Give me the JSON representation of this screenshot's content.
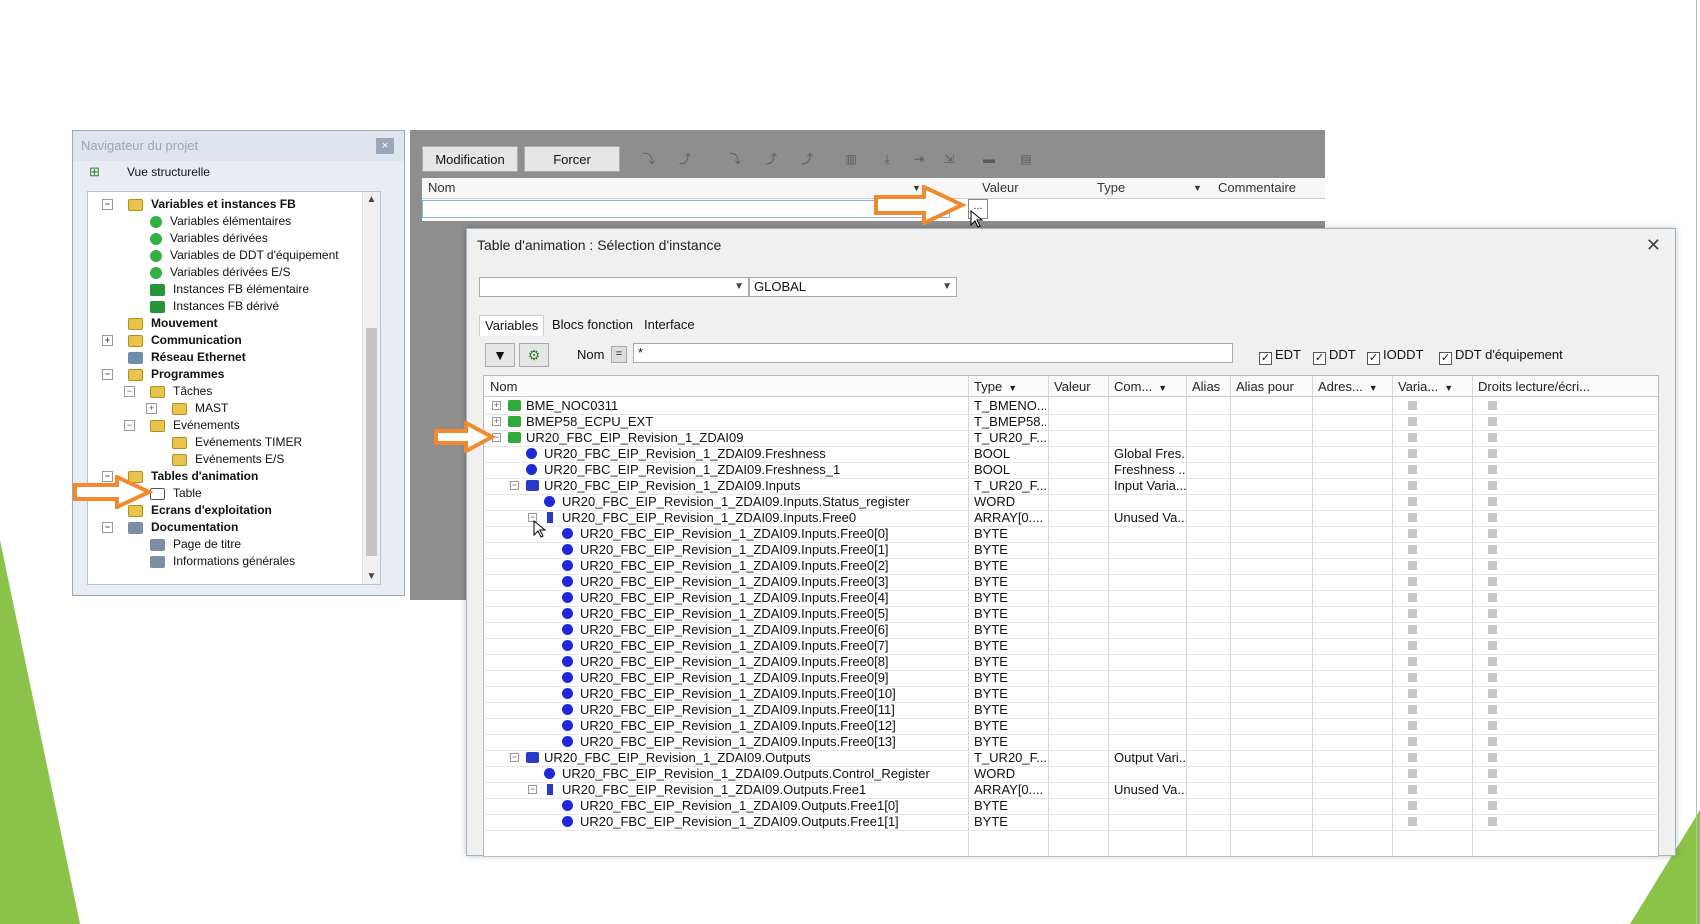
{
  "navigator": {
    "title": "Navigateur du projet",
    "close_label": "×",
    "view_label": "Vue structurelle",
    "items": [
      {
        "label": "Variables et instances FB",
        "bold": true,
        "level": 0,
        "icon": "folder-icon",
        "exp": "−"
      },
      {
        "label": "Variables élémentaires",
        "bold": false,
        "level": 1,
        "icon": "variable-icon"
      },
      {
        "label": "Variables dérivées",
        "bold": false,
        "level": 1,
        "icon": "variable-icon"
      },
      {
        "label": "Variables de DDT d'équipement",
        "bold": false,
        "level": 1,
        "icon": "variable-icon"
      },
      {
        "label": "Variables dérivées E/S",
        "bold": false,
        "level": 1,
        "icon": "variable-icon"
      },
      {
        "label": "Instances FB élémentaire",
        "bold": false,
        "level": 1,
        "icon": "fb-instance-icon"
      },
      {
        "label": "Instances FB dérivé",
        "bold": false,
        "level": 1,
        "icon": "fb-instance-icon"
      },
      {
        "label": "Mouvement",
        "bold": true,
        "level": 0,
        "icon": "folder-icon"
      },
      {
        "label": "Communication",
        "bold": true,
        "level": 0,
        "icon": "folder-icon",
        "exp": "+"
      },
      {
        "label": "Réseau Ethernet",
        "bold": true,
        "level": 0,
        "icon": "network-icon"
      },
      {
        "label": "Programmes",
        "bold": true,
        "level": 0,
        "icon": "folder-icon",
        "exp": "−"
      },
      {
        "label": "Tâches",
        "bold": false,
        "level": 1,
        "icon": "folder-icon",
        "exp": "−"
      },
      {
        "label": "MAST",
        "bold": false,
        "level": 2,
        "icon": "folder-icon",
        "exp": "+"
      },
      {
        "label": "Evénements",
        "bold": false,
        "level": 1,
        "icon": "folder-icon",
        "exp": "−"
      },
      {
        "label": "Evénements TIMER",
        "bold": false,
        "level": 2,
        "icon": "folder-icon"
      },
      {
        "label": "Evénements E/S",
        "bold": false,
        "level": 2,
        "icon": "folder-icon"
      },
      {
        "label": "Tables d'animation",
        "bold": true,
        "level": 0,
        "icon": "folder-icon",
        "exp": "−"
      },
      {
        "label": "Table",
        "bold": false,
        "level": 1,
        "icon": "table-icon"
      },
      {
        "label": "Ecrans d'exploitation",
        "bold": true,
        "level": 0,
        "icon": "folder-icon"
      },
      {
        "label": "Documentation",
        "bold": true,
        "level": 0,
        "icon": "documentation-icon",
        "exp": "−"
      },
      {
        "label": "Page de titre",
        "bold": false,
        "level": 1,
        "icon": "title-page-icon"
      },
      {
        "label": "Informations générales",
        "bold": false,
        "level": 1,
        "icon": "info-icon"
      }
    ]
  },
  "animation_table": {
    "buttons": {
      "modify": "Modification",
      "force": "Forcer"
    },
    "toolbar_icons": [
      "unforce-icon",
      "force-icon",
      "set-icon",
      "reset-icon",
      "toggle-icon",
      "columns-icon",
      "down-icon",
      "step-icon",
      "jump-icon",
      "filter-table-icon",
      "properties-icon"
    ],
    "columns": [
      "Nom",
      "Valeur",
      "Type",
      "Commentaire"
    ],
    "dots_label": "..."
  },
  "dialog": {
    "title": "Table d'animation : Sélection d'instance",
    "close_label": "✕",
    "combo1": "",
    "combo2": "GLOBAL",
    "tabs": [
      "Variables",
      "Blocs fonction",
      "Interface"
    ],
    "name_label": "Nom",
    "eq_label": "=",
    "filter_value": "*",
    "checkboxes": [
      "EDT",
      "DDT",
      "IODDT",
      "DDT d'équipement"
    ],
    "columns": [
      "Nom",
      "Type",
      "Valeur",
      "Com...",
      "Alias",
      "Alias pour",
      "Adres...",
      "Varia...",
      "Droits lecture/écri..."
    ],
    "rows": [
      {
        "level": 0,
        "icon": "group-icon",
        "exp": "+",
        "name": "BME_NOC0311",
        "type": "T_BMENO...",
        "comment": ""
      },
      {
        "level": 0,
        "icon": "group-icon",
        "exp": "+",
        "name": "BMEP58_ECPU_EXT",
        "type": "T_BMEP58...",
        "comment": ""
      },
      {
        "level": 0,
        "icon": "group-icon",
        "exp": "−",
        "name": "UR20_FBC_EIP_Revision_1_ZDAI09",
        "type": "T_UR20_F...",
        "comment": ""
      },
      {
        "level": 1,
        "icon": "dot-icon",
        "name": "UR20_FBC_EIP_Revision_1_ZDAI09.Freshness",
        "type": "BOOL",
        "comment": "Global Fres..."
      },
      {
        "level": 1,
        "icon": "dot-icon",
        "name": "UR20_FBC_EIP_Revision_1_ZDAI09.Freshness_1",
        "type": "BOOL",
        "comment": "Freshness ..."
      },
      {
        "level": 1,
        "icon": "block-icon",
        "exp": "−",
        "name": "UR20_FBC_EIP_Revision_1_ZDAI09.Inputs",
        "type": "T_UR20_F...",
        "comment": "Input Varia..."
      },
      {
        "level": 2,
        "icon": "dot-icon",
        "name": "UR20_FBC_EIP_Revision_1_ZDAI09.Inputs.Status_register",
        "type": "WORD",
        "comment": ""
      },
      {
        "level": 2,
        "icon": "array-icon",
        "exp": "−",
        "name": "UR20_FBC_EIP_Revision_1_ZDAI09.Inputs.Free0",
        "type": "ARRAY[0....",
        "comment": "Unused Va..."
      },
      {
        "level": 3,
        "icon": "dot-icon",
        "name": "UR20_FBC_EIP_Revision_1_ZDAI09.Inputs.Free0[0]",
        "type": "BYTE",
        "comment": ""
      },
      {
        "level": 3,
        "icon": "dot-icon",
        "name": "UR20_FBC_EIP_Revision_1_ZDAI09.Inputs.Free0[1]",
        "type": "BYTE",
        "comment": ""
      },
      {
        "level": 3,
        "icon": "dot-icon",
        "name": "UR20_FBC_EIP_Revision_1_ZDAI09.Inputs.Free0[2]",
        "type": "BYTE",
        "comment": ""
      },
      {
        "level": 3,
        "icon": "dot-icon",
        "name": "UR20_FBC_EIP_Revision_1_ZDAI09.Inputs.Free0[3]",
        "type": "BYTE",
        "comment": ""
      },
      {
        "level": 3,
        "icon": "dot-icon",
        "name": "UR20_FBC_EIP_Revision_1_ZDAI09.Inputs.Free0[4]",
        "type": "BYTE",
        "comment": ""
      },
      {
        "level": 3,
        "icon": "dot-icon",
        "name": "UR20_FBC_EIP_Revision_1_ZDAI09.Inputs.Free0[5]",
        "type": "BYTE",
        "comment": ""
      },
      {
        "level": 3,
        "icon": "dot-icon",
        "name": "UR20_FBC_EIP_Revision_1_ZDAI09.Inputs.Free0[6]",
        "type": "BYTE",
        "comment": ""
      },
      {
        "level": 3,
        "icon": "dot-icon",
        "name": "UR20_FBC_EIP_Revision_1_ZDAI09.Inputs.Free0[7]",
        "type": "BYTE",
        "comment": ""
      },
      {
        "level": 3,
        "icon": "dot-icon",
        "name": "UR20_FBC_EIP_Revision_1_ZDAI09.Inputs.Free0[8]",
        "type": "BYTE",
        "comment": ""
      },
      {
        "level": 3,
        "icon": "dot-icon",
        "name": "UR20_FBC_EIP_Revision_1_ZDAI09.Inputs.Free0[9]",
        "type": "BYTE",
        "comment": ""
      },
      {
        "level": 3,
        "icon": "dot-icon",
        "name": "UR20_FBC_EIP_Revision_1_ZDAI09.Inputs.Free0[10]",
        "type": "BYTE",
        "comment": ""
      },
      {
        "level": 3,
        "icon": "dot-icon",
        "name": "UR20_FBC_EIP_Revision_1_ZDAI09.Inputs.Free0[11]",
        "type": "BYTE",
        "comment": ""
      },
      {
        "level": 3,
        "icon": "dot-icon",
        "name": "UR20_FBC_EIP_Revision_1_ZDAI09.Inputs.Free0[12]",
        "type": "BYTE",
        "comment": ""
      },
      {
        "level": 3,
        "icon": "dot-icon",
        "name": "UR20_FBC_EIP_Revision_1_ZDAI09.Inputs.Free0[13]",
        "type": "BYTE",
        "comment": ""
      },
      {
        "level": 1,
        "icon": "block-icon",
        "exp": "−",
        "name": "UR20_FBC_EIP_Revision_1_ZDAI09.Outputs",
        "type": "T_UR20_F...",
        "comment": "Output Vari..."
      },
      {
        "level": 2,
        "icon": "dot-icon",
        "name": "UR20_FBC_EIP_Revision_1_ZDAI09.Outputs.Control_Register",
        "type": "WORD",
        "comment": ""
      },
      {
        "level": 2,
        "icon": "array-icon",
        "exp": "−",
        "name": "UR20_FBC_EIP_Revision_1_ZDAI09.Outputs.Free1",
        "type": "ARRAY[0....",
        "comment": "Unused Va..."
      },
      {
        "level": 3,
        "icon": "dot-icon",
        "name": "UR20_FBC_EIP_Revision_1_ZDAI09.Outputs.Free1[0]",
        "type": "BYTE",
        "comment": ""
      },
      {
        "level": 3,
        "icon": "dot-icon",
        "name": "UR20_FBC_EIP_Revision_1_ZDAI09.Outputs.Free1[1]",
        "type": "BYTE",
        "comment": ""
      }
    ]
  },
  "colors": {
    "arrow": "#f08a2c",
    "accent_green": "#8bc34a",
    "dot_blue": "#1b2ad6"
  }
}
